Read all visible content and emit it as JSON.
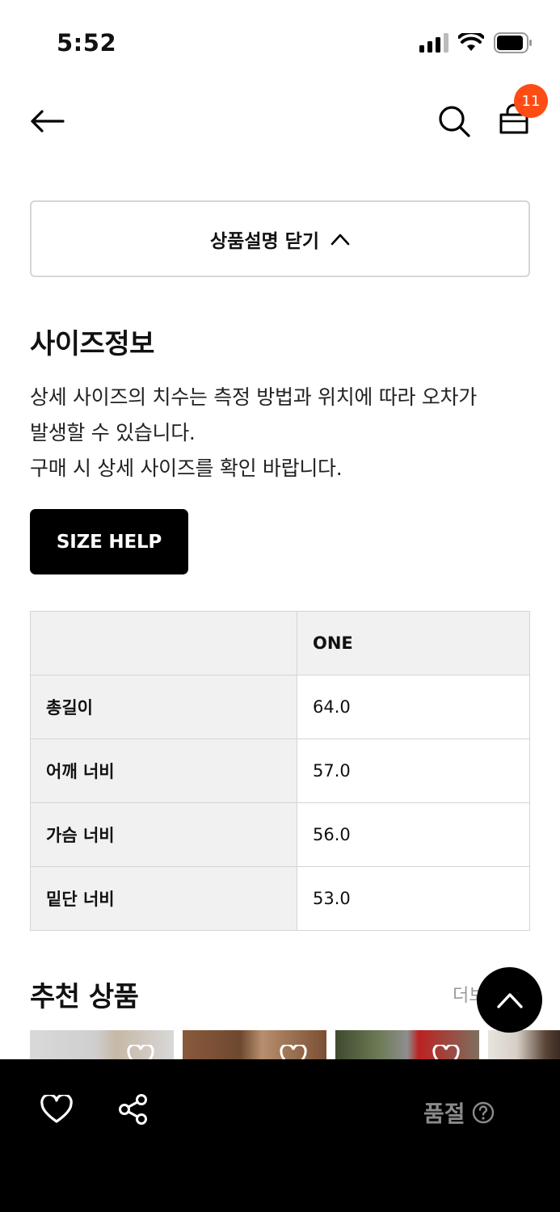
{
  "status_bar": {
    "time": "5:52"
  },
  "header": {
    "cart_count": "11"
  },
  "collapse_button": {
    "label": "상품설명 닫기"
  },
  "size_info": {
    "title": "사이즈정보",
    "description_lines": [
      "상세 사이즈의 치수는 측정 방법과 위치에 따라 오차가",
      "발생할 수 있습니다.",
      "구매 시 상세 사이즈를 확인 바랍니다."
    ],
    "help_button": "SIZE HELP",
    "table": {
      "header": [
        "",
        "ONE"
      ],
      "rows": [
        {
          "label": "총길이",
          "value": "64.0"
        },
        {
          "label": "어깨 너비",
          "value": "57.0"
        },
        {
          "label": "가슴 너비",
          "value": "56.0"
        },
        {
          "label": "밑단 너비",
          "value": "53.0"
        }
      ]
    }
  },
  "recommended": {
    "title": "추천 상품",
    "more_label": "더보"
  },
  "bottom_bar": {
    "status_label": "품절"
  },
  "colors": {
    "accent_badge": "#ff4c14",
    "bottom_bar": "#000000"
  }
}
